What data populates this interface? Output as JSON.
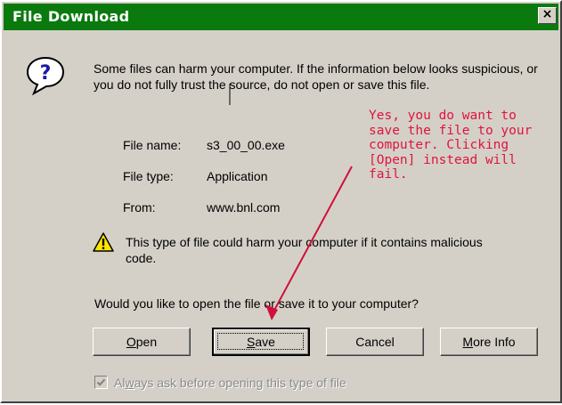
{
  "window": {
    "title": "File Download",
    "close_glyph": "×",
    "title_bar_color": "#0a7a0e"
  },
  "message": {
    "icon": "question-icon",
    "intro": "Some files can harm your computer. If the information below looks suspicious, or you do not fully trust the source, do not open or save this file."
  },
  "file_info": [
    {
      "label": "File name:",
      "value": "s3_00_00.exe"
    },
    {
      "label": "File type:",
      "value": "Application"
    },
    {
      "label": "From:",
      "value": "www.bnl.com"
    }
  ],
  "warning": {
    "icon": "warning-icon",
    "text": "This type of file could harm your computer if it contains malicious code."
  },
  "question": "Would you like to open the file or save it to your computer?",
  "buttons": {
    "open": {
      "accel": "O",
      "rest": "pen"
    },
    "save": {
      "accel": "S",
      "rest": "ave"
    },
    "cancel": "Cancel",
    "more_info": {
      "accel": "M",
      "rest": "ore Info"
    }
  },
  "checkbox": {
    "checked": true,
    "label_pre": "Al",
    "accel": "w",
    "label_post": "ays ask before opening this type of file"
  },
  "annotation": {
    "text": "Yes, you do want to\nsave the file to your\ncomputer. Clicking\n[Open] instead will fail.",
    "color": "#e0143c"
  }
}
